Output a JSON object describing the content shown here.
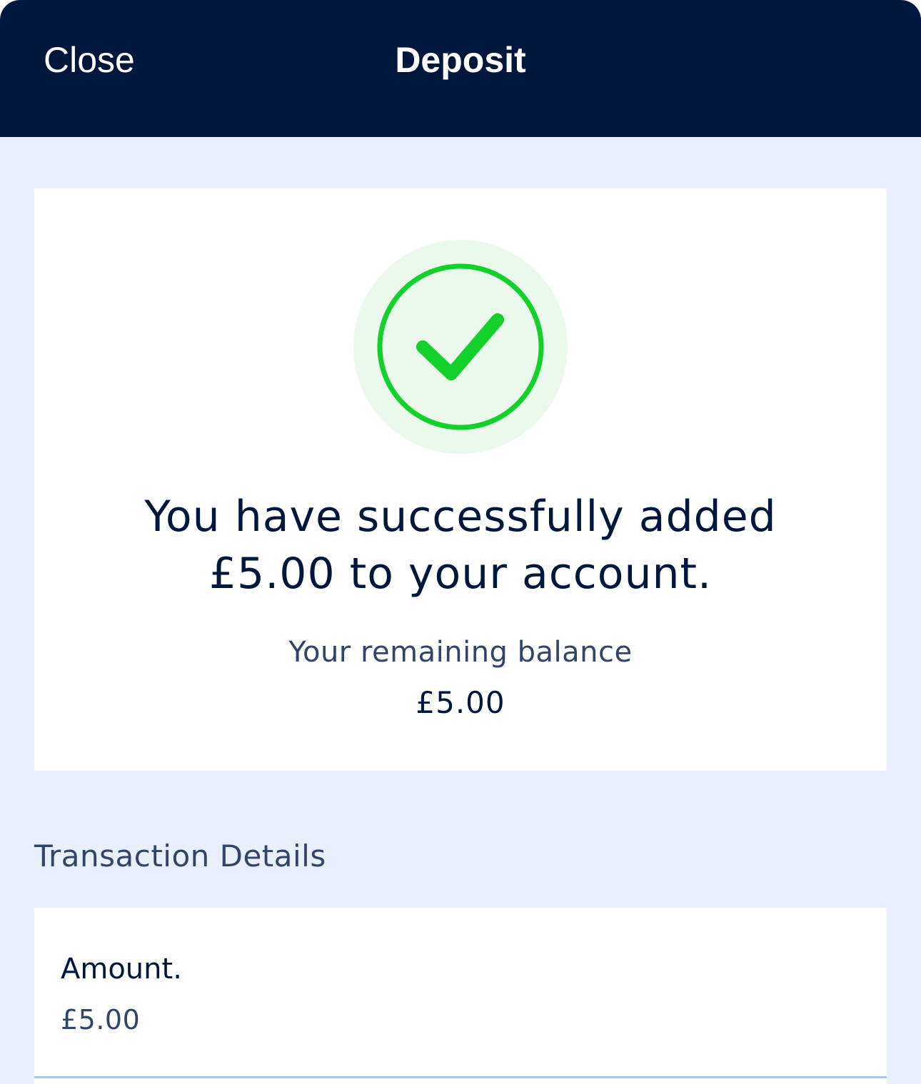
{
  "nav": {
    "close_label": "Close",
    "title": "Deposit"
  },
  "success": {
    "icon": "check-circle-icon",
    "message_line1": "You have successfully added",
    "message_line2": "£5.00 to your account.",
    "balance_label": "Your remaining balance",
    "balance_value": "£5.00"
  },
  "transaction": {
    "section_title": "Transaction Details",
    "items": [
      {
        "label": "Amount.",
        "value": "£5.00"
      }
    ]
  },
  "colors": {
    "nav_background": "#00173d",
    "page_background": "#e9effd",
    "success_green": "#12d12b",
    "success_halo": "#ebf8ec",
    "divider": "#a9c6f5"
  }
}
